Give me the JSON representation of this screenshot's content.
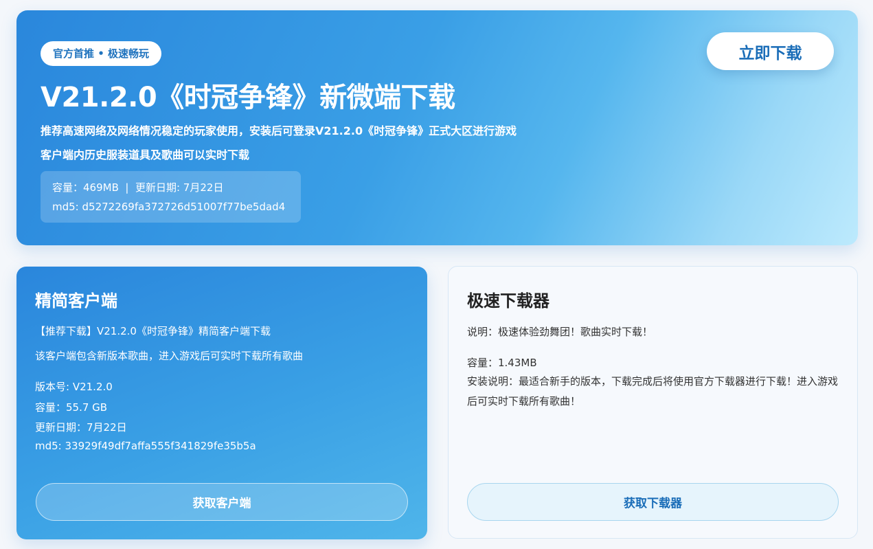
{
  "hero": {
    "badge": "官方首推 • 极速畅玩",
    "title": "V21.2.0《时冠争锋》新微端下载",
    "desc_line1": "推荐高速网络及网络情况稳定的玩家使用，安装后可登录V21.2.0《时冠争锋》正式大区进行游戏",
    "desc_line2": "客户端内历史服装道具及歌曲可以实时下载",
    "meta_line1": "容量：469MB  |  更新日期: 7月22日",
    "meta_line2": "md5: d5272269fa372726d51007f77be5dad4",
    "download_label": "立即下载"
  },
  "lite_client": {
    "title": "精简客户端",
    "line1": "【推荐下载】V21.2.0《时冠争锋》精简客户端下载",
    "line2": "该客户端包含新版本歌曲，进入游戏后可实时下载所有歌曲",
    "version": "版本号: V21.2.0",
    "size": "容量：55.7 GB",
    "date": "更新日期：7月22日",
    "md5": "md5: 33929f49df7affa555f341829fe35b5a",
    "button_label": "获取客户端"
  },
  "fast_downloader": {
    "title": "极速下载器",
    "desc": "说明：极速体验劲舞团！歌曲实时下载！",
    "size": "容量：1.43MB",
    "install_note": "安装说明：最适合新手的版本，下载完成后将使用官方下载器进行下载！进入游戏后可实时下载所有歌曲！",
    "button_label": "获取下载器"
  }
}
